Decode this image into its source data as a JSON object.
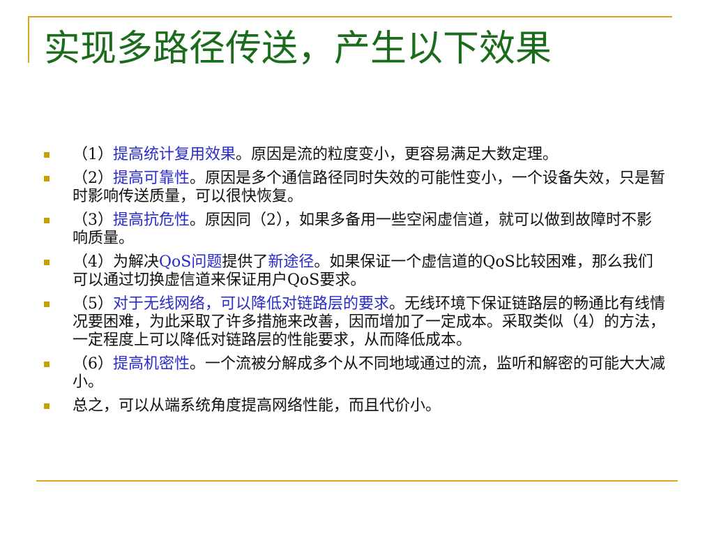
{
  "slide": {
    "title": "实现多路径传送，产生以下效果",
    "colors": {
      "accent_rule": "#d9a520",
      "title": "#1a6b1a",
      "highlight": "#2a2ac8",
      "bullet": "#c8a000",
      "body": "#111111"
    },
    "bullets": [
      {
        "parts": [
          {
            "text": "（1）",
            "hl": false
          },
          {
            "text": "提高统计复用效果",
            "hl": true
          },
          {
            "text": "。原因是流的粒度变小，更容易满足大数定理。",
            "hl": false
          }
        ]
      },
      {
        "parts": [
          {
            "text": "（2）",
            "hl": false
          },
          {
            "text": "提高可靠性",
            "hl": true
          },
          {
            "text": "。原因是多个通信路径同时失效的可能性变小，一个设备失效，只是暂时影响传送质量，可以很快恢复。",
            "hl": false
          }
        ]
      },
      {
        "parts": [
          {
            "text": "（3）",
            "hl": false
          },
          {
            "text": "提高抗危性",
            "hl": true
          },
          {
            "text": "。原因同（2），如果多备用一些空闲虚信道，就可以做到故障时不影响质量。",
            "hl": false
          }
        ]
      },
      {
        "parts": [
          {
            "text": "（4）为解决",
            "hl": false
          },
          {
            "text": "QoS问题",
            "hl": true
          },
          {
            "text": "提供了",
            "hl": false
          },
          {
            "text": "新途径",
            "hl": true
          },
          {
            "text": "。如果保证一个虚信道的QoS比较困难，那么我们可以通过切换虚信道来保证用户QoS要求。",
            "hl": false
          }
        ]
      },
      {
        "parts": [
          {
            "text": "（5）",
            "hl": false
          },
          {
            "text": "对于无线网络，可以降低对链路层的要求",
            "hl": true
          },
          {
            "text": "。无线环境下保证链路层的畅通比有线情况要困难，为此采取了许多措施来改善，因而增加了一定成本。采取类似（4）的方法，一定程度上可以降低对链路层的性能要求，从而降低成本。",
            "hl": false
          }
        ]
      },
      {
        "parts": [
          {
            "text": "（6）",
            "hl": false
          },
          {
            "text": "提高机密性",
            "hl": true
          },
          {
            "text": "。一个流被分解成多个从不同地域通过的流，监听和解密的可能大大减小。",
            "hl": false
          }
        ]
      },
      {
        "parts": [
          {
            "text": "总之，可以从端系统角度提高网络性能，而且代价小。",
            "hl": false
          }
        ]
      }
    ]
  }
}
